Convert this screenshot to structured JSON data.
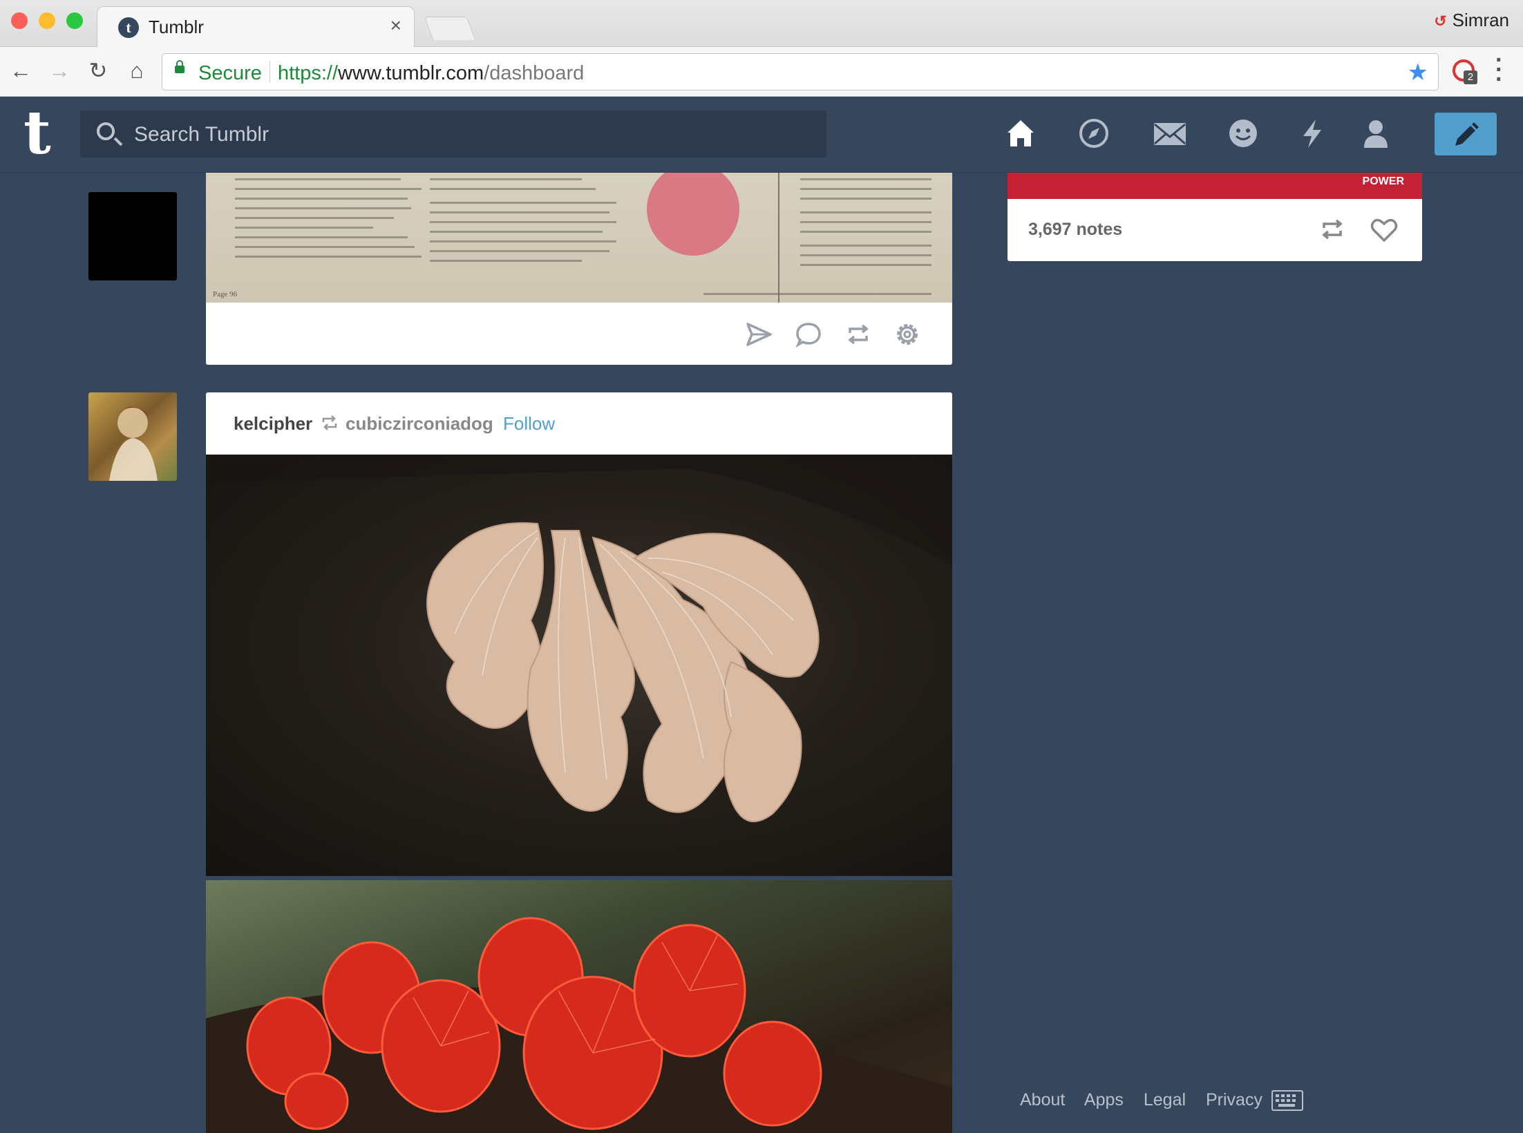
{
  "browser": {
    "tab_title": "Tumblr",
    "tab_close": "×",
    "profile_name": "Simran",
    "secure_label": "Secure",
    "url_scheme": "https://",
    "url_domain": "www.tumblr.com",
    "url_path": "/dashboard",
    "extension_badge": "2"
  },
  "header": {
    "logo": "t",
    "search_placeholder": "Search Tumblr",
    "nav_icons": [
      "home-icon",
      "explore-icon",
      "inbox-icon",
      "messaging-icon",
      "activity-icon",
      "account-icon"
    ],
    "compose_icon": "pencil-icon",
    "accent_color": "#529ecc",
    "background_color": "#36465d"
  },
  "posts": [
    {
      "clip_footer": "Page 96",
      "actions": [
        "share-icon",
        "reply-icon",
        "reblog-icon",
        "settings-icon"
      ]
    },
    {
      "blog_name": "kelcipher",
      "source_blog": "cubiczirconiadog",
      "follow_label": "Follow"
    }
  ],
  "sidebar": {
    "banner_text": "POWER",
    "notes": "3,697 notes"
  },
  "footer": {
    "links": [
      "About",
      "Apps",
      "Legal",
      "Privacy"
    ]
  }
}
